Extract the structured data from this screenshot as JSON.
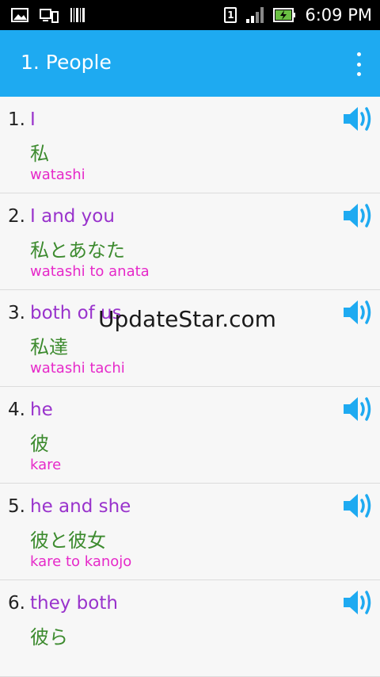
{
  "status_bar": {
    "time": "6:09 PM",
    "sim_label": "1",
    "icons": [
      "image-icon",
      "cast-icon",
      "barcode-icon",
      "sim-icon",
      "signal-icon",
      "battery-charging-icon"
    ]
  },
  "app_bar": {
    "title": "1. People",
    "menu_icon": "overflow-menu-icon",
    "color": "#1eaaf1"
  },
  "phrases": [
    {
      "num": "1.",
      "english": "I",
      "japanese": "私",
      "romaji": "watashi"
    },
    {
      "num": "2.",
      "english": "I and you",
      "japanese": "私とあなた",
      "romaji": "watashi to anata"
    },
    {
      "num": "3.",
      "english": "both of us",
      "japanese": "私達",
      "romaji": "watashi tachi"
    },
    {
      "num": "4.",
      "english": "he",
      "japanese": "彼",
      "romaji": "kare"
    },
    {
      "num": "5.",
      "english": "he and she",
      "japanese": "彼と彼女",
      "romaji": "kare to kanojo"
    },
    {
      "num": "6.",
      "english": "they both",
      "japanese": "彼ら",
      "romaji": ""
    }
  ],
  "colors": {
    "english": "#9933cc",
    "japanese": "#3d8b2f",
    "romaji": "#e629c9",
    "speaker": "#1eaaf1"
  },
  "watermark": "UpdateStar.com"
}
